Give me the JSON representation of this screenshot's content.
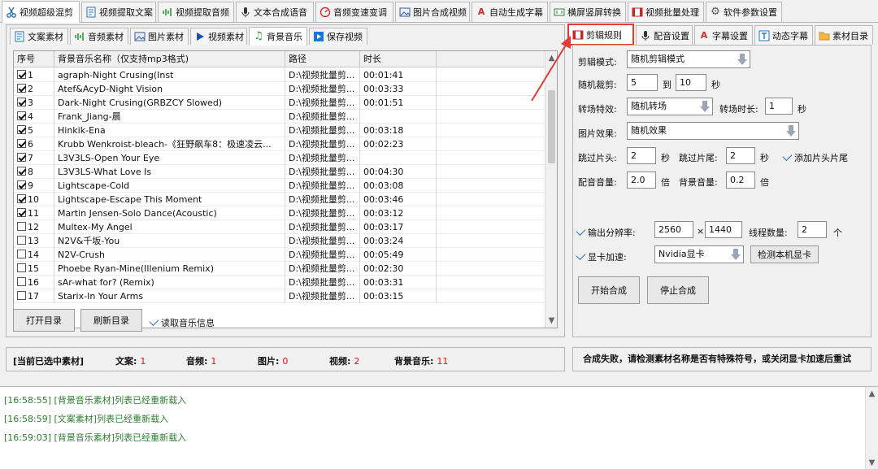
{
  "top_tabs": [
    {
      "label": "视频超级混剪",
      "icon": "scissors-icon"
    },
    {
      "label": "视频提取文案",
      "icon": "document-icon"
    },
    {
      "label": "视频提取音频",
      "icon": "audio-wave-icon"
    },
    {
      "label": "文本合成语音",
      "icon": "microphone-icon"
    },
    {
      "label": "音频变速变调",
      "icon": "speedometer-icon"
    },
    {
      "label": "图片合成视频",
      "icon": "image-icon"
    },
    {
      "label": "自动生成字幕",
      "icon": "subtitle-icon"
    },
    {
      "label": "横屏竖屏转换",
      "icon": "screen-rotate-icon"
    },
    {
      "label": "视频批量处理",
      "icon": "film-icon"
    },
    {
      "label": "软件参数设置",
      "icon": "gear-icon"
    }
  ],
  "sub_tabs": [
    {
      "label": "文案素材",
      "icon": "document-icon"
    },
    {
      "label": "音频素材",
      "icon": "audio-wave-icon"
    },
    {
      "label": "图片素材",
      "icon": "image-icon"
    },
    {
      "label": "视频素材",
      "icon": "play-icon"
    },
    {
      "label": "背景音乐",
      "icon": "music-note-icon"
    },
    {
      "label": "保存视频",
      "icon": "save-video-icon"
    }
  ],
  "table": {
    "headers": [
      "序号",
      "背景音乐名称（仅支持mp3格式)",
      "路径",
      "时长"
    ],
    "rows": [
      {
        "checked": true,
        "no": "1",
        "name": "agraph-Night Crusing(Inst",
        "path": "D:\\视频批量剪...",
        "duration": "00:01:41"
      },
      {
        "checked": true,
        "no": "2",
        "name": "Atef&AcyD-Night Vision",
        "path": "D:\\视频批量剪...",
        "duration": "00:03:33"
      },
      {
        "checked": true,
        "no": "3",
        "name": "Dark-Night Crusing(GRBZCY Slowed)",
        "path": "D:\\视频批量剪...",
        "duration": "00:01:51"
      },
      {
        "checked": true,
        "no": "4",
        "name": "Frank_Jiang-晨",
        "path": "D:\\视频批量剪...",
        "duration": ""
      },
      {
        "checked": true,
        "no": "5",
        "name": "Hinkik-Ena",
        "path": "D:\\视频批量剪...",
        "duration": "00:03:18"
      },
      {
        "checked": true,
        "no": "6",
        "name": "Krubb Wenkroist-bleach-《狂野飙车8：极速凌云...",
        "path": "D:\\视频批量剪...",
        "duration": "00:02:23"
      },
      {
        "checked": true,
        "no": "7",
        "name": "L3V3LS-Open Your Eye",
        "path": "D:\\视频批量剪...",
        "duration": ""
      },
      {
        "checked": true,
        "no": "8",
        "name": "L3V3LS-What Love Is",
        "path": "D:\\视频批量剪...",
        "duration": "00:04:30"
      },
      {
        "checked": true,
        "no": "9",
        "name": "Lightscape-Cold",
        "path": "D:\\视频批量剪...",
        "duration": "00:03:08"
      },
      {
        "checked": true,
        "no": "10",
        "name": "Lightscape-Escape This Moment",
        "path": "D:\\视频批量剪...",
        "duration": "00:03:46"
      },
      {
        "checked": true,
        "no": "11",
        "name": "Martin Jensen-Solo Dance(Acoustic)",
        "path": "D:\\视频批量剪...",
        "duration": "00:03:12"
      },
      {
        "checked": false,
        "no": "12",
        "name": "Multex-My Angel",
        "path": "D:\\视频批量剪...",
        "duration": "00:03:17"
      },
      {
        "checked": false,
        "no": "13",
        "name": "N2V&千坂-You",
        "path": "D:\\视频批量剪...",
        "duration": "00:03:24"
      },
      {
        "checked": false,
        "no": "14",
        "name": "N2V-Crush",
        "path": "D:\\视频批量剪...",
        "duration": "00:05:49"
      },
      {
        "checked": false,
        "no": "15",
        "name": "Phoebe Ryan-Mine(Illenium Remix)",
        "path": "D:\\视频批量剪...",
        "duration": "00:02:30"
      },
      {
        "checked": false,
        "no": "16",
        "name": "sAr-what for? (Remix)",
        "path": "D:\\视频批量剪...",
        "duration": "00:03:31"
      },
      {
        "checked": false,
        "no": "17",
        "name": "Starix-In Your Arms",
        "path": "D:\\视频批量剪...",
        "duration": "00:03:15"
      }
    ]
  },
  "left_buttons": {
    "open_dir": "打开目录",
    "refresh_dir": "刷新目录",
    "read_info": "读取音乐信息"
  },
  "status": {
    "label": "[当前已选中素材]",
    "items": [
      {
        "label": "文案:",
        "value": "1"
      },
      {
        "label": "音频:",
        "value": "1"
      },
      {
        "label": "图片:",
        "value": "0"
      },
      {
        "label": "视频:",
        "value": "2"
      },
      {
        "label": "背景音乐:",
        "value": "11"
      }
    ]
  },
  "right_tabs": [
    {
      "label": "剪辑规则",
      "icon": "film-icon"
    },
    {
      "label": "配音设置",
      "icon": "microphone-icon"
    },
    {
      "label": "字幕设置",
      "icon": "subtitle-icon"
    },
    {
      "label": "动态字幕",
      "icon": "text-box-icon"
    },
    {
      "label": "素材目录",
      "icon": "folder-icon"
    }
  ],
  "settings": {
    "mode_label": "剪辑模式:",
    "mode_value": "随机剪辑模式",
    "crop_label": "随机裁剪:",
    "crop_from": "5",
    "crop_to_label": "到",
    "crop_to": "10",
    "crop_unit": "秒",
    "transition_label": "转场特效:",
    "transition_value": "随机转场",
    "transition_time_label": "转场时长:",
    "transition_time": "1",
    "transition_unit": "秒",
    "image_effect_label": "图片效果:",
    "image_effect_value": "随机效果",
    "skip_head_label": "跳过片头:",
    "skip_head": "2",
    "skip_head_unit": "秒",
    "skip_tail_label": "跳过片尾:",
    "skip_tail": "2",
    "skip_tail_unit": "秒",
    "add_head_tail_label": "添加片头片尾",
    "voice_vol_label": "配音音量:",
    "voice_vol": "2.0",
    "voice_vol_unit": "倍",
    "bg_vol_label": "背景音量:",
    "bg_vol": "0.2",
    "bg_vol_unit": "倍",
    "resolution_label": "输出分辨率:",
    "res_w": "2560",
    "res_x": "×",
    "res_h": "1440",
    "threads_label": "线程数量:",
    "threads": "2",
    "threads_unit": "个",
    "gpu_label": "显卡加速:",
    "gpu_value": "Nvidia显卡",
    "detect_gpu": "检测本机显卡",
    "start_btn": "开始合成",
    "stop_btn": "停止合成"
  },
  "right_status": "合成失败，请检测素材名称是否有特殊符号，或关闭显卡加速后重试",
  "log": [
    "[16:58:55] [背景音乐素材]列表已经重新载入",
    "[16:58:59] [文案素材]列表已经重新载入",
    "[16:59:03] [背景音乐素材]列表已经重新载入"
  ],
  "colors": {
    "accent_red": "#e53935",
    "log_green": "#2e7d32",
    "status_red": "#e01010",
    "check_blue": "#2a6fb8"
  }
}
